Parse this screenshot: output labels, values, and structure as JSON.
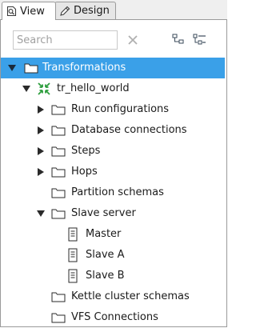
{
  "tabs": [
    {
      "label": "View",
      "icon": "view-icon",
      "active": true
    },
    {
      "label": "Design",
      "icon": "pencil-icon",
      "active": false
    }
  ],
  "search": {
    "placeholder": "Search",
    "value": ""
  },
  "toolbar": {
    "clear_icon": "close-icon",
    "collapse_icon": "tree-collapse-icon",
    "expand_icon": "tree-expand-icon"
  },
  "tree": {
    "root": {
      "label": "Transformations",
      "icon": "folder-icon",
      "expanded": true,
      "selected": true
    },
    "transformation": {
      "label": "tr_hello_world",
      "icon": "transformation-icon",
      "expanded": true
    },
    "items": [
      {
        "label": "Run configurations",
        "expandable": true,
        "expanded": false
      },
      {
        "label": "Database connections",
        "expandable": true,
        "expanded": false
      },
      {
        "label": "Steps",
        "expandable": true,
        "expanded": false
      },
      {
        "label": "Hops",
        "expandable": true,
        "expanded": false
      },
      {
        "label": "Partition schemas",
        "expandable": false
      },
      {
        "label": "Slave server",
        "expandable": true,
        "expanded": true
      },
      {
        "label": "Kettle cluster schemas",
        "expandable": false
      },
      {
        "label": "VFS Connections",
        "expandable": false
      }
    ],
    "slave_servers": [
      "Master",
      "Slave A",
      "Slave B"
    ]
  },
  "colors": {
    "selection": "#3aa0e8",
    "accent_green": "#2e9e3e",
    "triangle": "#2a2a2a"
  }
}
